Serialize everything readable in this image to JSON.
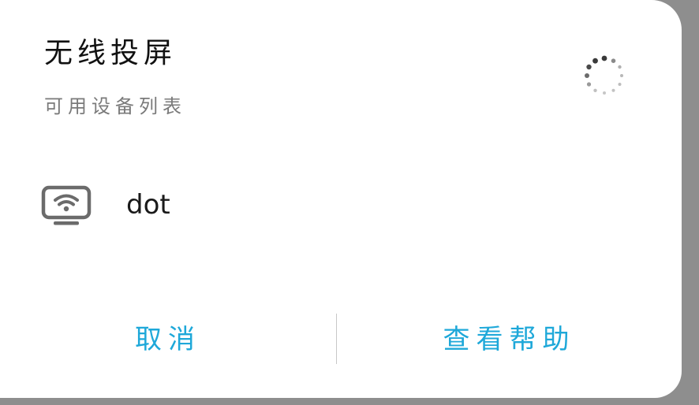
{
  "dialog": {
    "title": "无线投屏",
    "subtitle": "可用设备列表",
    "loading_icon": "loading-spinner-icon"
  },
  "devices": [
    {
      "name": "dot",
      "icon": "wireless-display-icon"
    }
  ],
  "actions": {
    "cancel_label": "取消",
    "help_label": "查看帮助"
  },
  "colors": {
    "accent": "#1ea8d9",
    "title": "#111111",
    "subtitle": "#7a7a7a",
    "icon": "#6b6b6b"
  }
}
